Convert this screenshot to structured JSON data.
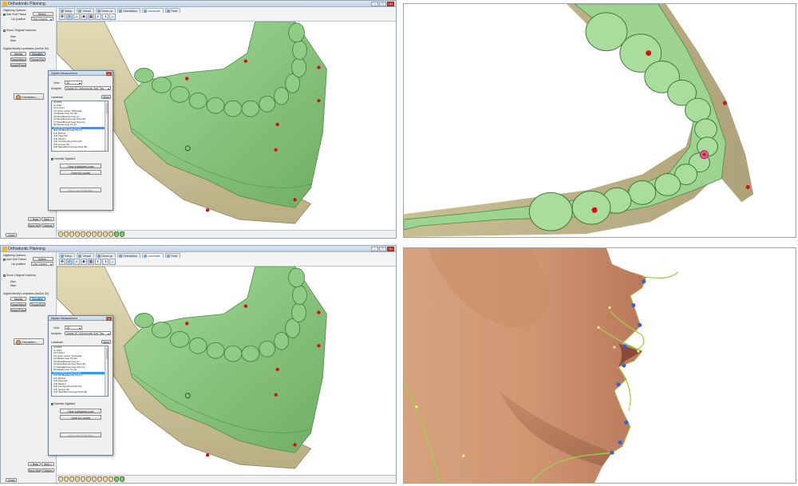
{
  "window": {
    "title": "Orthodontic Planning"
  },
  "left_panel": {
    "digitizing_options": "Digitizing Options:",
    "add_soft_tissue": "Add Soft Tissue",
    "select_btn": "Select...",
    "lip_position_label": "Lip position",
    "lip_position_value": "Lips Closed",
    "show_original_volumes": "Show Original Volumes",
    "field_a": "Max",
    "field_b": "Man",
    "section_title": "Digitize/Modify Landmarks (Ins/Del Sh)",
    "btn_maxilla": "Maxilla",
    "btn_mandible": "Mandible",
    "btn_nasal": "Nasal/Naso",
    "btn_tissue": "Tissue/Soft",
    "btn_nodal": "Nodal/Fixed",
    "orientation_btn": "Orientation...",
    "back_btn": "< Back",
    "next_btn": "Next >",
    "save_next_btn": "Save Next",
    "options_btn": "Options",
    "close_btn": "Close"
  },
  "toolbar": {
    "tabs": [
      "Setup",
      "Virtual",
      "Clean-up",
      "Orientation",
      "Landmark",
      "Treat"
    ],
    "active_tab": "Landmark"
  },
  "dialog": {
    "title": "Digitize Measurement",
    "view_label": "View",
    "view_value": "3D",
    "analysis_label": "Analysis",
    "analysis_value": "Digital 3D Orthodontic Soft Tiss",
    "landmark_label": "Landmark",
    "more_btn": "More",
    "landmarks": [
      "(0) PNS",
      "(1) ANS",
      "(2) A-Point",
      "(3) Upper Incisor Tip/Incisal",
      "(4) Mesial Cusp Tip (R)",
      "(5) MesioBuccal Cusp (L)",
      "(6) MesioBuccal Cusp Point (R)",
      "(7) MesioBuccal Cusp Point (L)",
      "(8) Mesial Cusp Tip (L)",
      "(9) LM Mesial Cusp Tip (R)",
      "(10) LM Mesial Cusp Tip (L)",
      "(11) B-Point",
      "(12) Pogonion",
      "(13) Menton",
      "(14) Condyle Ring Point (R)",
      "(15) Gonion (R)",
      "(16) MesioBuccal Cusp Point (R)"
    ],
    "selected_index": 9,
    "invisible_label": "Invisible Digitized",
    "clear_btn": "Clear highlighted point",
    "clear_all_btn": "Clear ALL points",
    "undo_btn": "Undo Last Digitization"
  },
  "colors": {
    "tooth_green": "#8fcc86",
    "tooth_green_dark": "#5b9a55",
    "bone_beige": "#d4cba2",
    "landmark_red": "#d01218",
    "skin": "#d8a07a",
    "curve_green": "#9fd04a"
  }
}
